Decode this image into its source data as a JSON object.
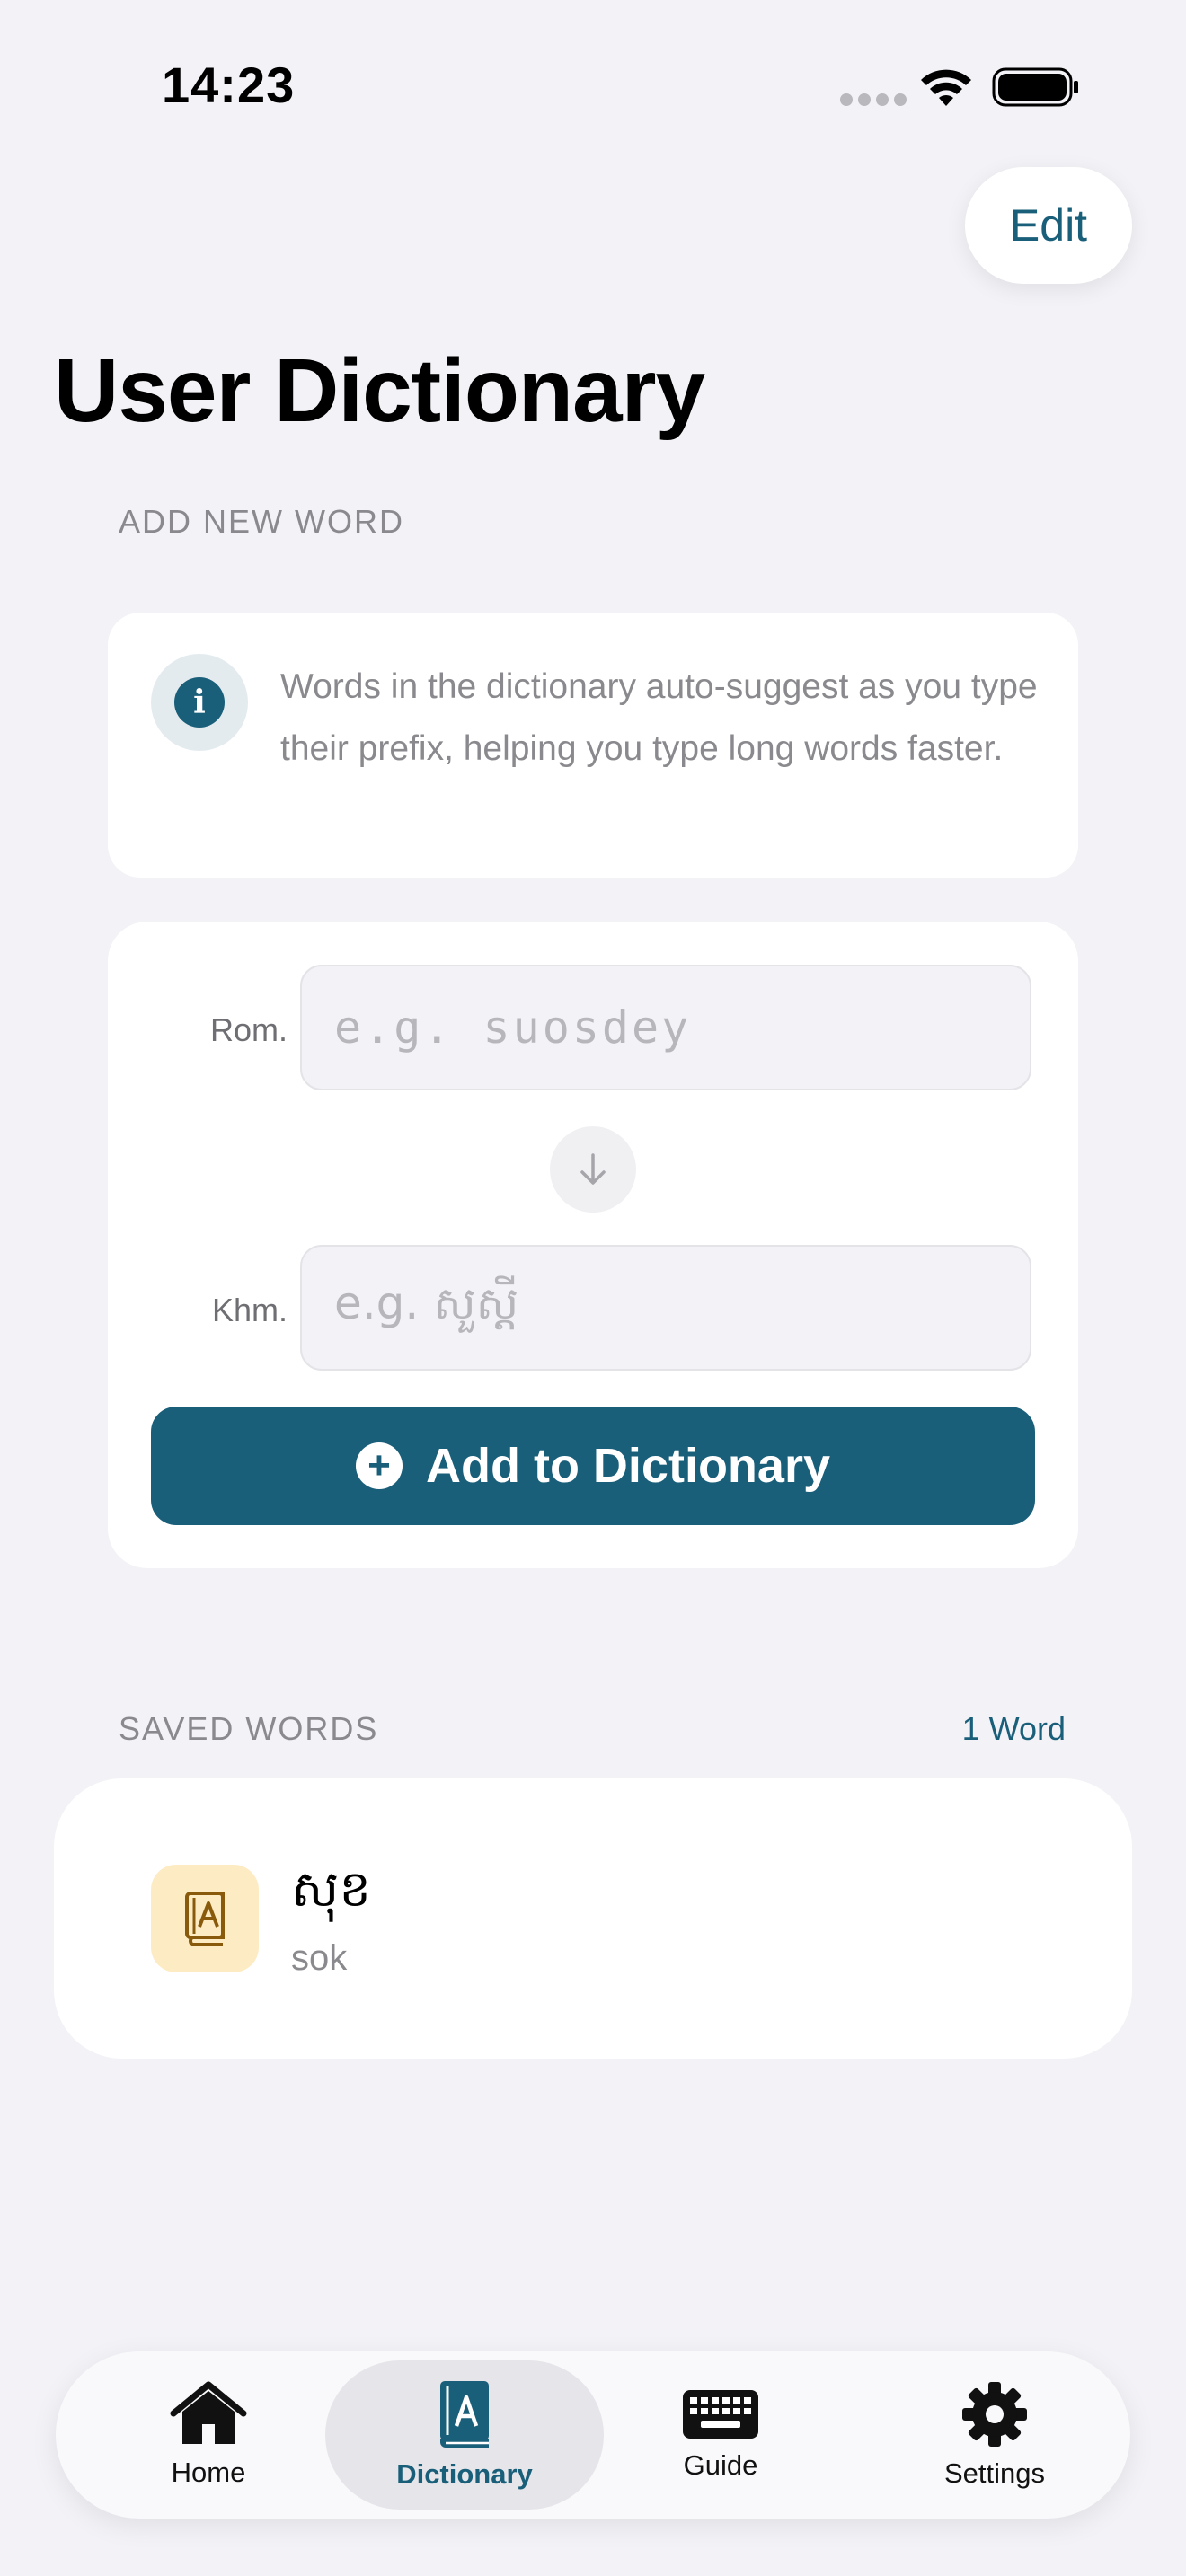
{
  "status_bar": {
    "time": "14:23"
  },
  "header": {
    "edit_label": "Edit",
    "title": "User Dictionary"
  },
  "add_section": {
    "label": "ADD NEW WORD",
    "info_text": "Words in the dictionary auto-suggest as you type their prefix, helping you type long words faster.",
    "rom_label": "Rom.",
    "rom_placeholder": "e.g. suosdey",
    "khm_label": "Khm.",
    "khm_placeholder": "e.g. សួស្តី",
    "add_button_label": "Add to Dictionary"
  },
  "saved_section": {
    "label": "SAVED WORDS",
    "count_label": "1 Word",
    "words": [
      {
        "khmer": "សុខ",
        "roman": "sok"
      }
    ]
  },
  "tabs": [
    {
      "label": "Home",
      "icon": "house-icon"
    },
    {
      "label": "Dictionary",
      "icon": "book-icon",
      "selected": true
    },
    {
      "label": "Guide",
      "icon": "keyboard-icon"
    },
    {
      "label": "Settings",
      "icon": "gear-icon"
    }
  ],
  "colors": {
    "accent": "#1a5f7a",
    "background": "#f2f2f7",
    "word_icon_bg": "#fdecc3"
  }
}
